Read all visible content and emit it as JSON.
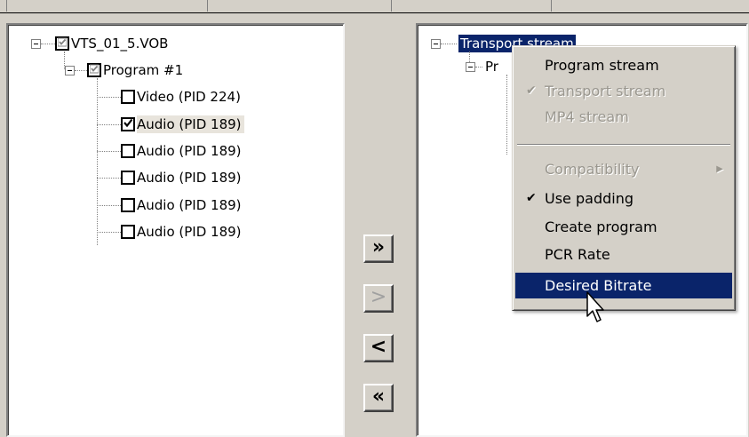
{
  "left_tree": {
    "root": {
      "label": "VTS_01_5.VOB",
      "checked": "partial"
    },
    "program": {
      "label": "Program #1",
      "checked": "partial"
    },
    "streams": [
      {
        "label": "Video (PID 224)",
        "checked": false
      },
      {
        "label": "Audio (PID 189)",
        "checked": true,
        "selected": true
      },
      {
        "label": "Audio (PID 189)",
        "checked": false
      },
      {
        "label": "Audio (PID 189)",
        "checked": false
      },
      {
        "label": "Audio (PID 189)",
        "checked": false
      },
      {
        "label": "Audio (PID 189)",
        "checked": false
      }
    ]
  },
  "buttons": {
    "add_all": "»",
    "add": ">",
    "remove": "<",
    "remove_all": "«"
  },
  "right_tree": {
    "root_label": "Transp",
    "root_label_tail": "ort stream",
    "child_label": "Pr"
  },
  "context_menu": {
    "items": [
      {
        "label": "Program stream",
        "enabled": true,
        "checked": false
      },
      {
        "label": "Transport stream",
        "enabled": false,
        "checked": true
      },
      {
        "label": "MP4 stream",
        "enabled": false,
        "checked": false
      },
      {
        "label": "Compatibility",
        "enabled": false,
        "checked": false,
        "submenu": true
      },
      {
        "label": "Use padding",
        "enabled": true,
        "checked": true
      },
      {
        "label": "Create program",
        "enabled": true,
        "checked": false
      },
      {
        "label": "PCR Rate",
        "enabled": true,
        "checked": false
      },
      {
        "label": "Desired Bitrate",
        "enabled": true,
        "checked": false,
        "highlighted": true
      }
    ]
  },
  "colors": {
    "selection": "#0a246a",
    "face": "#d4d0c8"
  }
}
